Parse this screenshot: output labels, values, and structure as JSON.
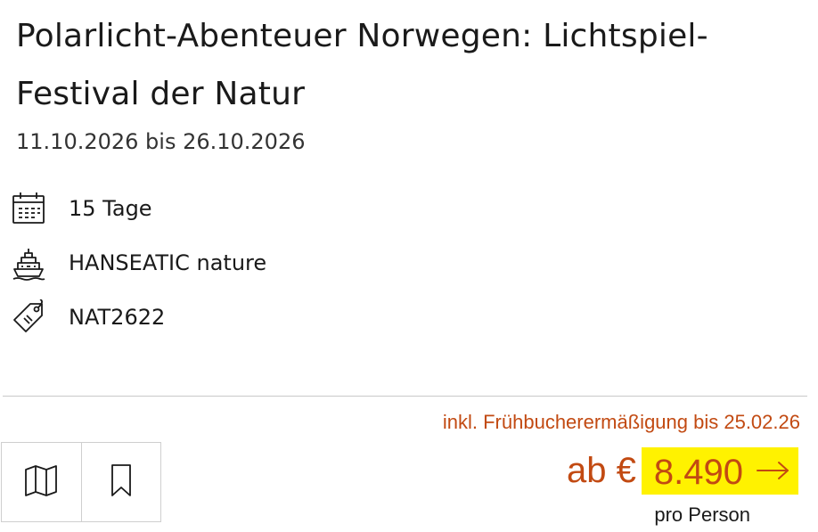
{
  "trip": {
    "title": "Polarlicht-Abenteuer Norwegen: Lichtspiel-Festival der Natur",
    "dates": "11.10.2026 bis 26.10.2026",
    "duration": "15 Tage",
    "ship": "HANSEATIC nature",
    "code": "NAT2622"
  },
  "icons": {
    "duration": "calendar-icon",
    "ship": "ship-icon",
    "code": "tag-icon",
    "map": "map-icon",
    "bookmark": "bookmark-icon",
    "arrow": "arrow-right-icon"
  },
  "pricing": {
    "discount_note": "inkl. Frühbucherermäßigung bis 25.02.26",
    "prefix": "ab €",
    "amount": "8.490",
    "per_person": "pro Person"
  },
  "colors": {
    "accent": "#c24a12",
    "highlight": "#fff200",
    "text": "#1a1a1a",
    "divider": "#c8c8c8"
  }
}
